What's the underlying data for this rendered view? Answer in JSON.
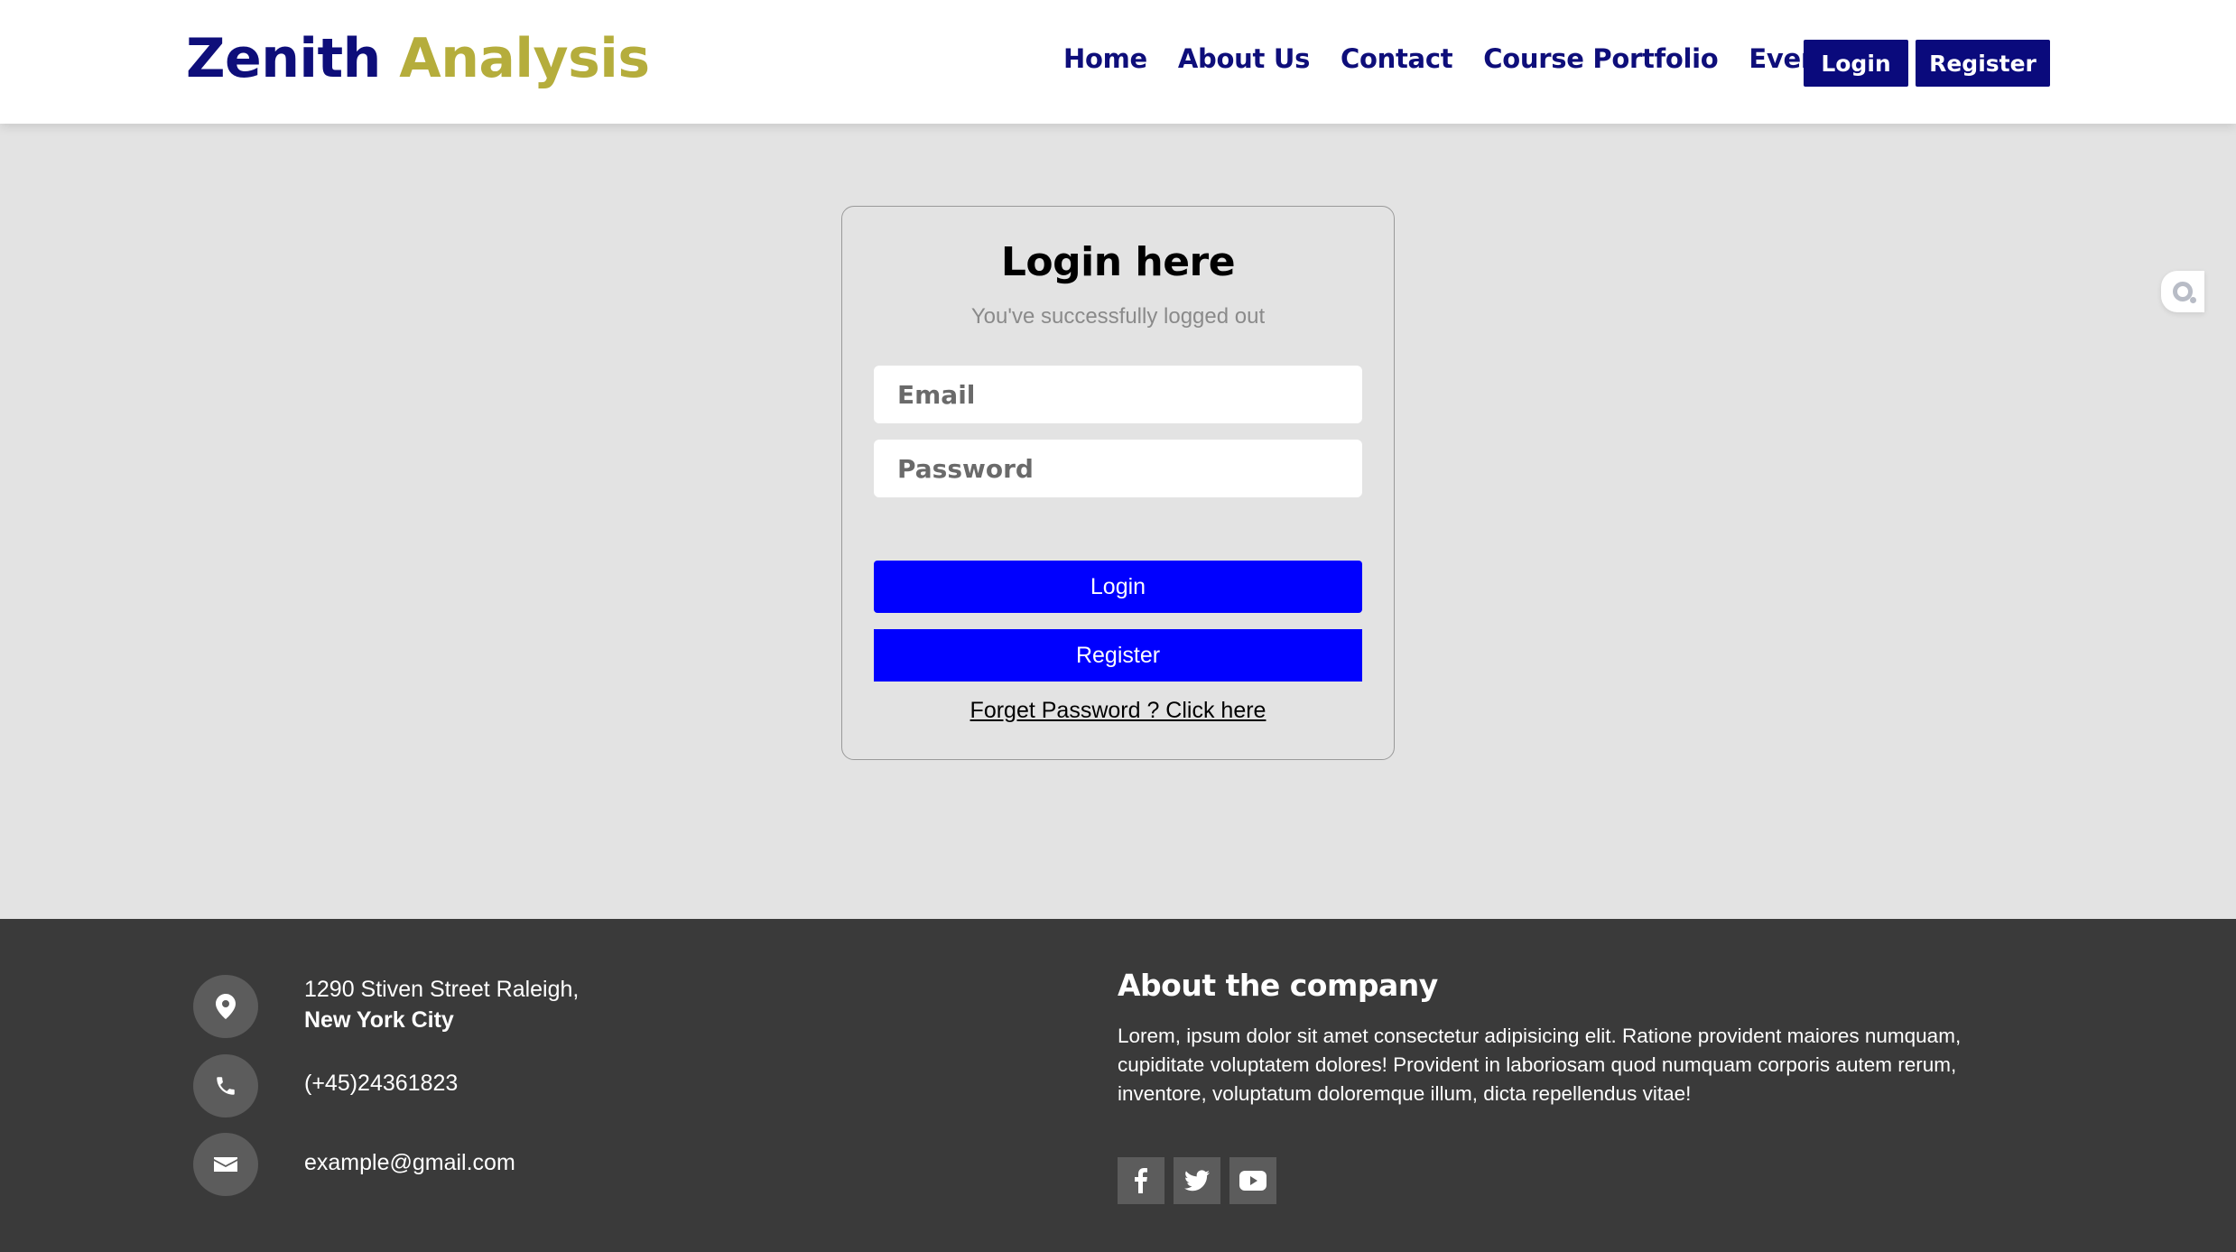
{
  "brand": {
    "part1": "Zenith",
    "part2": "Analysis",
    "color1": "#0e0e7a",
    "color2": "#b5ad3c"
  },
  "nav": {
    "items": [
      "Home",
      "About Us",
      "Contact",
      "Course Portfolio",
      "Event"
    ],
    "login_label": "Login",
    "register_label": "Register"
  },
  "login": {
    "title": "Login here",
    "status_message": "You've successfully logged out",
    "email_placeholder": "Email",
    "password_placeholder": "Password",
    "login_button": "Login",
    "register_button": "Register",
    "forgot_link": "Forget Password ? Click here"
  },
  "footer": {
    "address_line1": "1290 Stiven Street Raleigh,",
    "address_line2": "New York City",
    "phone": "(+45)24361823",
    "email": "example@gmail.com",
    "about_heading": "About the company",
    "about_text": "Lorem, ipsum dolor sit amet consectetur adipisicing elit. Ratione provident maiores numquam, cupiditate voluptatem dolores! Provident in laboriosam quod numquam corporis autem rerum, inventore, voluptatum doloremque illum, dicta repellendus vitae!",
    "socials": [
      "facebook-icon",
      "twitter-icon",
      "youtube-icon"
    ]
  },
  "colors": {
    "primary_button": "#0000ff",
    "header_button": "#0a0a7c",
    "footer_bg": "#3a3a3a",
    "page_bg": "#e3e3e3"
  }
}
